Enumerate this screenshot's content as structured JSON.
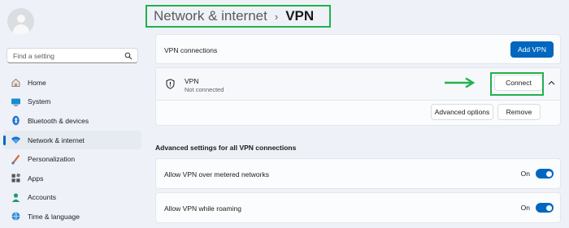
{
  "sidebar": {
    "search": {
      "placeholder": "Find a setting",
      "icon": "search-icon"
    },
    "items": [
      {
        "label": "Home",
        "icon": "home-icon",
        "active": false
      },
      {
        "label": "System",
        "icon": "monitor-icon",
        "active": false
      },
      {
        "label": "Bluetooth & devices",
        "icon": "bluetooth-icon",
        "active": false
      },
      {
        "label": "Network & internet",
        "icon": "wifi-icon",
        "active": true
      },
      {
        "label": "Personalization",
        "icon": "paintbrush-icon",
        "active": false
      },
      {
        "label": "Apps",
        "icon": "apps-icon",
        "active": false
      },
      {
        "label": "Accounts",
        "icon": "person-icon",
        "active": false
      },
      {
        "label": "Time & language",
        "icon": "globe-clock-icon",
        "active": false
      }
    ]
  },
  "breadcrumb": {
    "parent": "Network & internet",
    "separator": "›",
    "current": "VPN"
  },
  "vpn_connections": {
    "label": "VPN connections",
    "add_button": "Add VPN"
  },
  "vpn": {
    "name": "VPN",
    "status": "Not connected",
    "connect_button": "Connect",
    "advanced_button": "Advanced options",
    "remove_button": "Remove"
  },
  "advanced": {
    "heading": "Advanced settings for all VPN connections",
    "settings": [
      {
        "label": "Allow VPN over metered networks",
        "state": "On",
        "enabled": true
      },
      {
        "label": "Allow VPN while roaming",
        "state": "On",
        "enabled": true
      }
    ]
  },
  "colors": {
    "accent": "#0067c0",
    "highlight": "#22b14c",
    "background": "#eef2f8"
  }
}
